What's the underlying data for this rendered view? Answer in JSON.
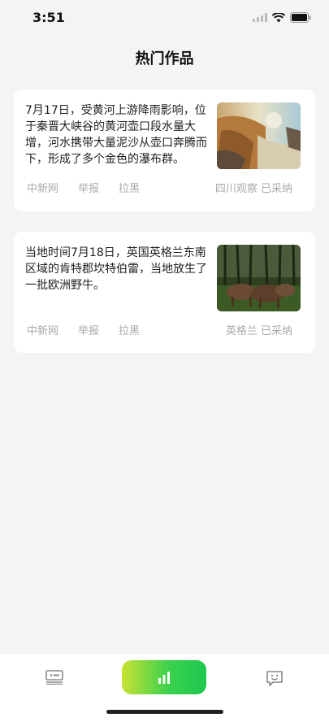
{
  "status": {
    "time": "3:51"
  },
  "header": {
    "title": "热门作品"
  },
  "cards": [
    {
      "text": "7月17日，受黄河上游降雨影响，位于秦晋大峡谷的黄河壶口段水量大增，河水携带大量泥沙从壶口奔腾而下，形成了多个金色的瀑布群。",
      "source": "中新网",
      "report": "举报",
      "block": "拉黑",
      "status": "四川观察 已采纳"
    },
    {
      "text": "当地时间7月18日，英国英格兰东南区域的肯特郡坎特伯雷，当地放生了一批欧洲野牛。",
      "source": "中新网",
      "report": "举报",
      "block": "拉黑",
      "status": "英格兰 已采纳"
    }
  ],
  "colors": {
    "accent_start": "#c9e234",
    "accent_end": "#1ec84f",
    "background": "#f4f4f4"
  },
  "tabbar": {
    "items": [
      {
        "icon": "news-icon"
      },
      {
        "icon": "chart-icon"
      },
      {
        "icon": "chat-smile-icon"
      }
    ]
  }
}
